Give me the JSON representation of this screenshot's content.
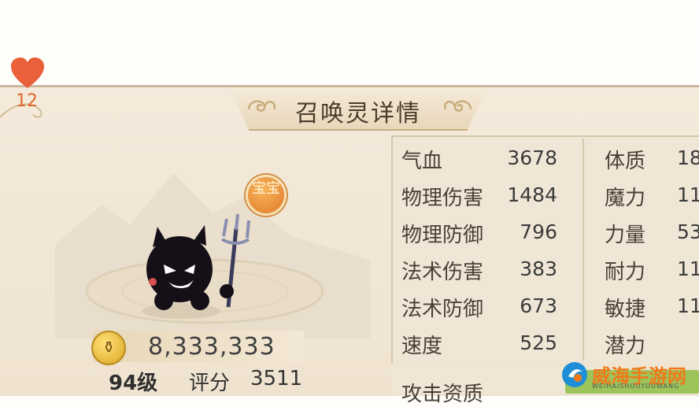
{
  "title": "召唤灵详情",
  "heart": {
    "icon": "heart-icon",
    "count": "12"
  },
  "badge": {
    "icon": "baobao-badge-icon",
    "text": "宝宝"
  },
  "pet": {
    "icon": "devil-pet-icon"
  },
  "coins": {
    "icon": "coin-icon",
    "value": "8,333,333"
  },
  "level": "94级",
  "score": {
    "label": "评分",
    "value": "3511"
  },
  "stats_left": [
    {
      "label": "气血",
      "value": "3678"
    },
    {
      "label": "物理伤害",
      "value": "1484"
    },
    {
      "label": "物理防御",
      "value": "796"
    },
    {
      "label": "法术伤害",
      "value": "383"
    },
    {
      "label": "法术防御",
      "value": "673"
    },
    {
      "label": "速度",
      "value": "525"
    }
  ],
  "stats_right": [
    {
      "label": "体质",
      "value": "18"
    },
    {
      "label": "魔力",
      "value": "11"
    },
    {
      "label": "力量",
      "value": "53"
    },
    {
      "label": "耐力",
      "value": "11"
    },
    {
      "label": "敏捷",
      "value": "11"
    },
    {
      "label": "潜力",
      "value": ""
    }
  ],
  "bottom_label": "攻击资质",
  "watermark": {
    "text": "威海手游网",
    "sub": "WEIHAISHOUYOUWANG"
  },
  "colors": {
    "heart": "#e9603a",
    "badge": "#e07a2a",
    "bar_green": "#9cc45a",
    "watermark": "#f07a1a"
  }
}
